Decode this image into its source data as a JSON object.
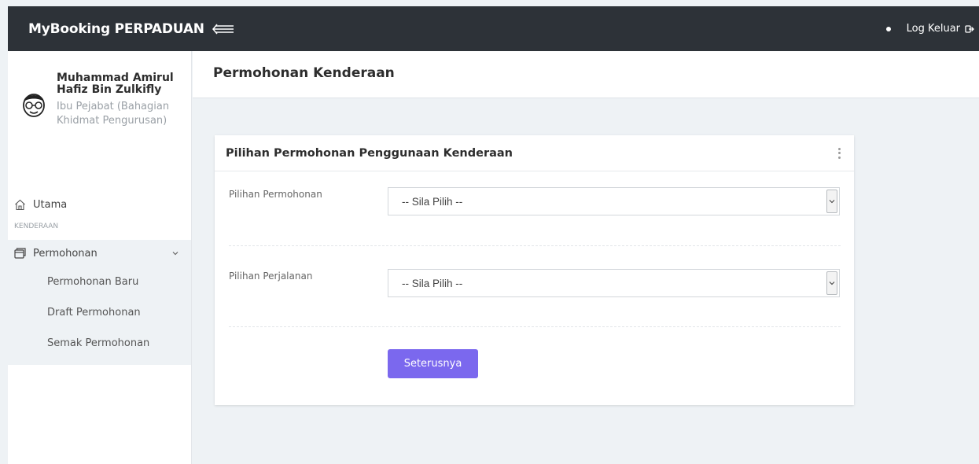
{
  "header": {
    "brand": "MyBooking PERPADUAN",
    "logout_label": "Log Keluar"
  },
  "profile": {
    "name": "Muhammad Amirul Hafiz Bin Zulkifly",
    "department": "Ibu Pejabat (Bahagian Khidmat Pengurusan)"
  },
  "sidebar": {
    "home_label": "Utama",
    "section_label": "KENDERAAN",
    "group_label": "Permohonan",
    "children": [
      "Permohonan Baru",
      "Draft Permohonan",
      "Semak Permohonan"
    ]
  },
  "page": {
    "title": "Permohonan Kenderaan"
  },
  "form": {
    "title": "Pilihan Permohonan Penggunaan Kenderaan",
    "fields": [
      {
        "label": "Pilihan Permohonan",
        "value": "-- Sila Pilih --"
      },
      {
        "label": "Pilihan Perjalanan",
        "value": "-- Sila Pilih --"
      }
    ],
    "submit_label": "Seterusnya"
  },
  "colors": {
    "topbar": "#2d3238",
    "accent": "#7b68ee",
    "background": "#eef2f5"
  },
  "icons": {
    "menu_toggle": "menu-collapse-icon",
    "logout": "logout-icon",
    "home": "home-icon",
    "requests": "folder-icon",
    "chevron": "chevron-down-icon",
    "options": "kebab-icon"
  }
}
